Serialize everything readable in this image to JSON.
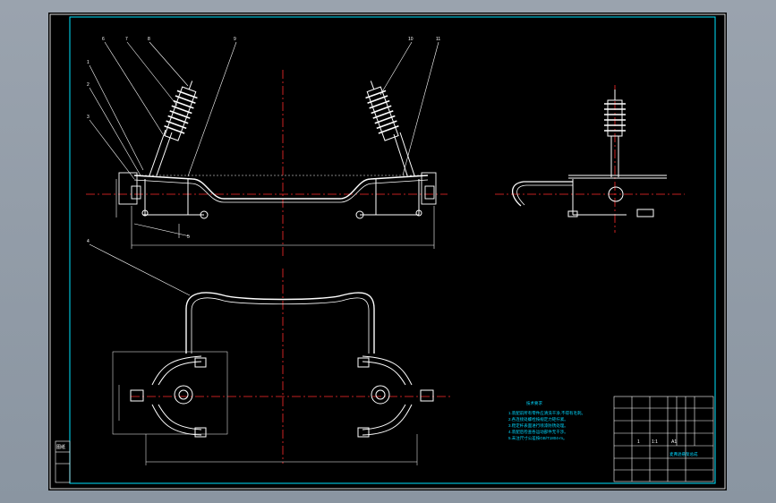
{
  "drawing": {
    "sheet": "CAD drawing sheet",
    "part_labels": [
      "1",
      "2",
      "3",
      "4",
      "5",
      "6",
      "7",
      "8",
      "9",
      "10",
      "11"
    ],
    "notes": {
      "heading": "技术要求",
      "lines": [
        "1.装配前所有零件应清洗干净,不得有毛刺。",
        "2.各连接处螺栓按规定力矩拧紧。",
        "3.稳定杆表面进行喷漆防锈处理。",
        "4.装配后检查各运动部件无干涉。",
        "5.未注尺寸公差按GB/T1804-m。"
      ]
    },
    "title_block": {
      "title": "麦弗逊悬架总成",
      "scale": "1:1",
      "qty": "1",
      "sheet_no": "A1"
    },
    "left_stamp": "图纸"
  },
  "colors": {
    "frame": "#00e5ff",
    "geometry": "#ffffff",
    "centerline": "#ff2b2b",
    "leader": "#ffffff",
    "dimension": "#00d7ff"
  }
}
